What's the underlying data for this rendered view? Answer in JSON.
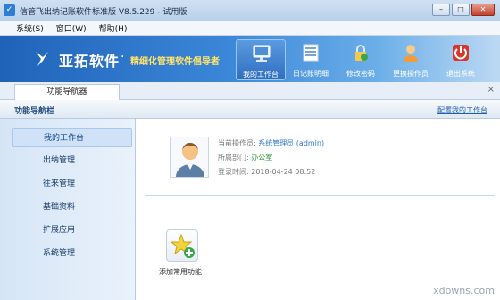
{
  "window": {
    "title": "信管飞出纳记账软件标准版 V8.5.229 - 试用版",
    "buttons": {
      "minimize": "–",
      "maximize": "□",
      "close": "✕"
    }
  },
  "menu": [
    "系统(S)",
    "窗口(W)",
    "帮助(H)"
  ],
  "banner": {
    "logo": "亚拓软件",
    "slogan": "精细化管理软件倡导者",
    "toolbar": [
      {
        "label": "我的工作台",
        "icon": "monitor-icon",
        "active": true
      },
      {
        "label": "日记账明细",
        "icon": "ledger-icon",
        "active": false
      },
      {
        "label": "修改密码",
        "icon": "lock-icon",
        "active": false
      },
      {
        "label": "更换操作员",
        "icon": "user-icon",
        "active": false
      },
      {
        "label": "退出系统",
        "icon": "power-icon",
        "active": false
      }
    ]
  },
  "tab": {
    "label": "功能导航器",
    "close": "×"
  },
  "nav_header": {
    "title": "功能导航栏",
    "link": "配置我的工作台"
  },
  "sidebar": {
    "items": [
      {
        "label": "我的工作台",
        "active": true
      },
      {
        "label": "出纳管理",
        "active": false
      },
      {
        "label": "往来管理",
        "active": false
      },
      {
        "label": "基础资料",
        "active": false
      },
      {
        "label": "扩展应用",
        "active": false
      },
      {
        "label": "系统管理",
        "active": false
      }
    ]
  },
  "user_info": {
    "operator_label": "当前操作员:",
    "operator_value": "系统管理员 (admin)",
    "dept_label": "所属部门:",
    "dept_value": "办公室",
    "login_label": "登录时间:",
    "login_value": "2018-04-24 08:52"
  },
  "quick": {
    "add_label": "添加常用功能"
  },
  "watermark": "xdowns.com",
  "colors": {
    "banner_start": "#1f63b8",
    "slogan": "#ffe36a",
    "link": "#1f5fb3"
  }
}
